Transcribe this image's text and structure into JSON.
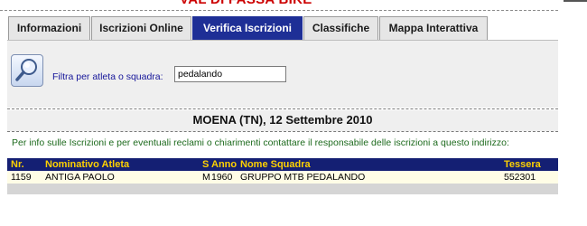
{
  "banner": {
    "title": "VAL DI FASSA BIKE"
  },
  "tabs": [
    {
      "label": "Informazioni",
      "active": false
    },
    {
      "label": "Iscrizioni Online",
      "active": false
    },
    {
      "label": "Verifica Iscrizioni",
      "active": true
    },
    {
      "label": "Classifiche",
      "active": false
    },
    {
      "label": "Mappa Interattiva",
      "active": false
    }
  ],
  "filter": {
    "icon": "search-magnifier-icon",
    "label": "Filtra per atleta o squadra:",
    "value": "pedalando"
  },
  "event": {
    "title": "MOENA (TN), 12 Settembre 2010"
  },
  "info": {
    "text": "Per info sulle Iscrizioni e per eventuali reclami o chiarimenti contattare il responsabile delle iscrizioni a questo indirizzo:"
  },
  "table": {
    "headers": {
      "nr": "Nr.",
      "name": "Nominativo Atleta",
      "sex": "S",
      "year": "Anno",
      "team": "Nome Squadra",
      "card": "Tessera"
    },
    "rows": [
      {
        "nr": "1159",
        "name": "ANTIGA PAOLO",
        "sex": "M",
        "year": "1960",
        "team": "GRUPPO MTB PEDALANDO",
        "card": "552301"
      }
    ]
  },
  "colors": {
    "active_tab": "#1e2f96",
    "header_bg": "#141f73",
    "header_text": "#ffd100",
    "row_bg": "#fffde6",
    "info_text": "#1d6a1d",
    "label_text": "#16169a",
    "banner_text": "#cc0000"
  }
}
